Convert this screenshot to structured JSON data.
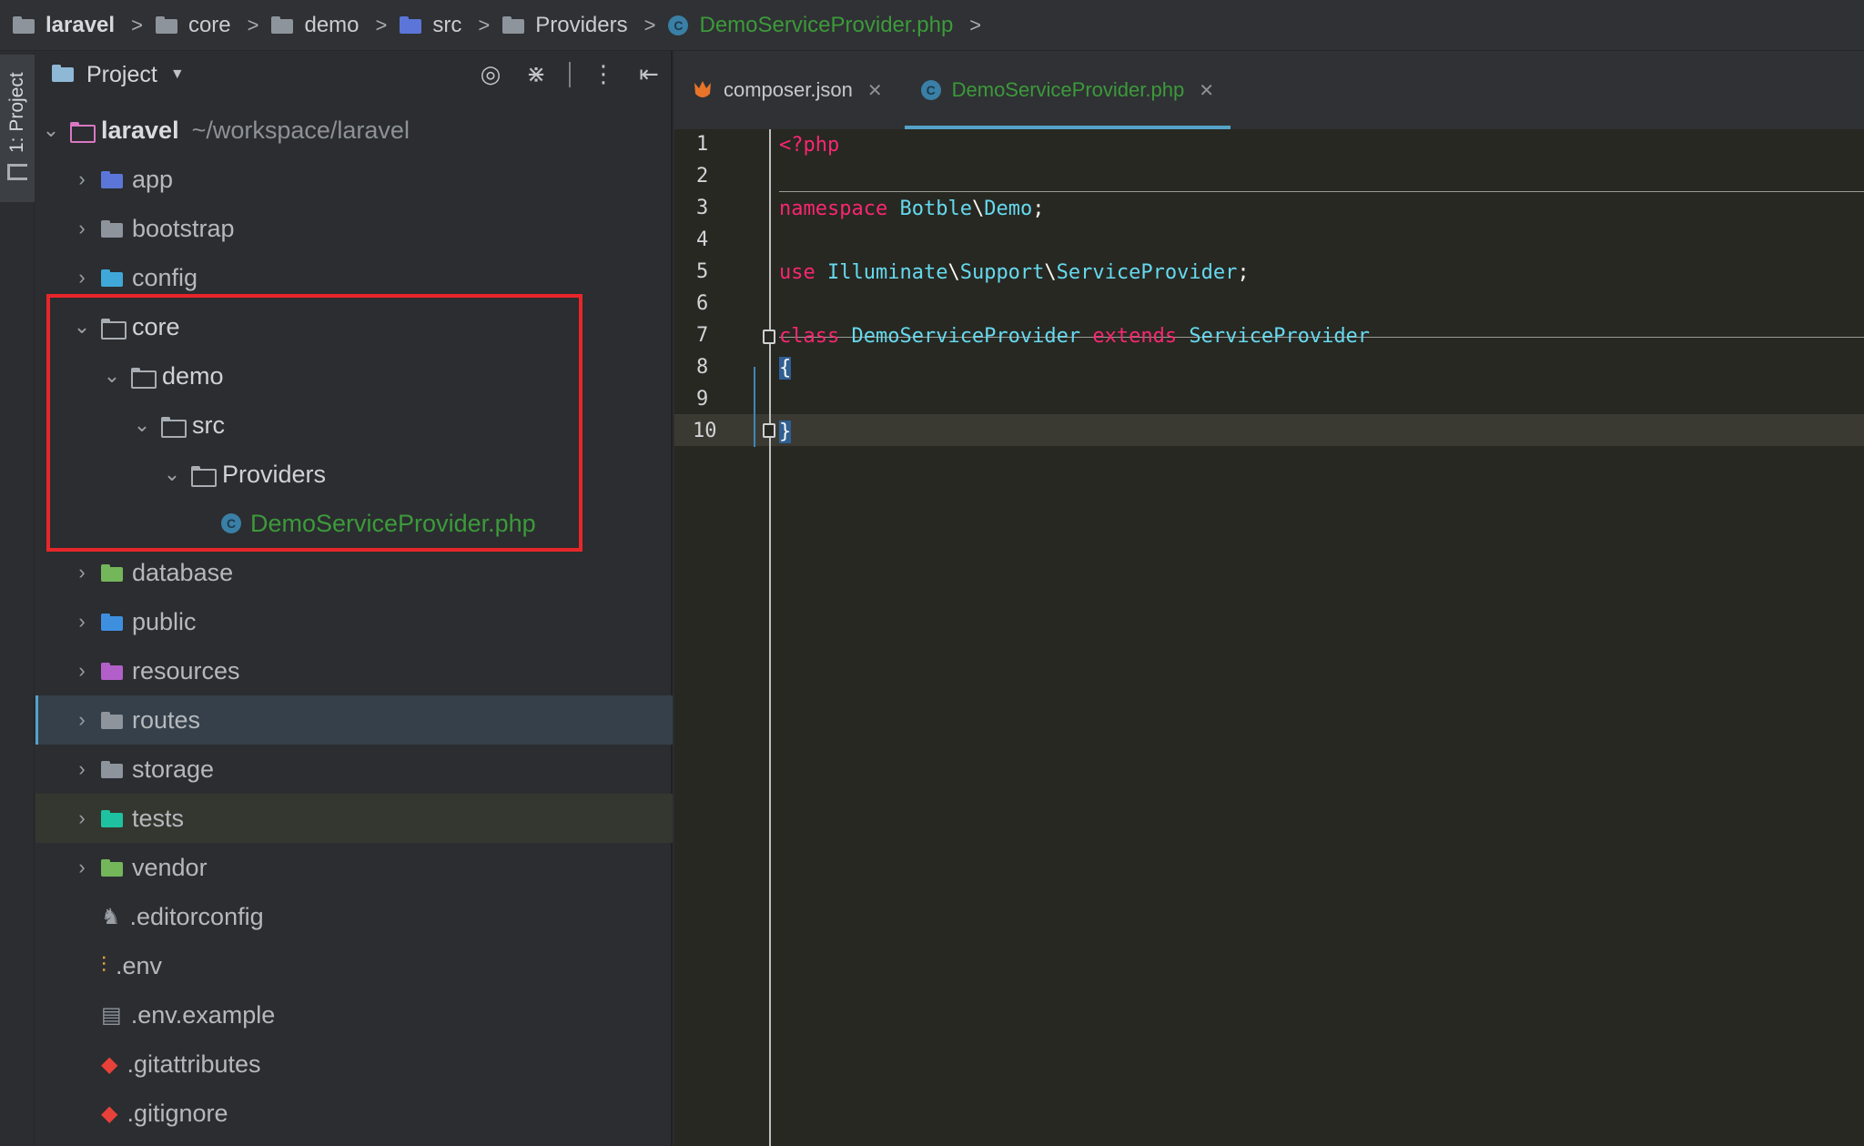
{
  "breadcrumb": [
    "laravel",
    "core",
    "demo",
    "src",
    "Providers",
    "DemoServiceProvider.php"
  ],
  "toolwindow": {
    "tab_label": "1: Project"
  },
  "project_panel": {
    "title": "Project",
    "root": {
      "name": "laravel",
      "path": "~/workspace/laravel"
    },
    "items": [
      {
        "name": "app"
      },
      {
        "name": "bootstrap"
      },
      {
        "name": "config"
      },
      {
        "name": "core"
      },
      {
        "name": "demo"
      },
      {
        "name": "src"
      },
      {
        "name": "Providers"
      },
      {
        "name": "DemoServiceProvider.php"
      },
      {
        "name": "database"
      },
      {
        "name": "public"
      },
      {
        "name": "resources"
      },
      {
        "name": "routes"
      },
      {
        "name": "storage"
      },
      {
        "name": "tests"
      },
      {
        "name": "vendor"
      },
      {
        "name": ".editorconfig"
      },
      {
        "name": ".env"
      },
      {
        "name": ".env.example"
      },
      {
        "name": ".gitattributes"
      },
      {
        "name": ".gitignore"
      }
    ]
  },
  "tabs": [
    {
      "label": "composer.json"
    },
    {
      "label": "DemoServiceProvider.php"
    }
  ],
  "editor": {
    "line_numbers": [
      "1",
      "2",
      "3",
      "4",
      "5",
      "6",
      "7",
      "8",
      "9",
      "10"
    ],
    "code": {
      "l1": "<?php",
      "l3_kw": "namespace",
      "l3_a": "Botble",
      "l3_sep": "\\",
      "l3_b": "Demo",
      "l3_end": ";",
      "l5_kw": "use",
      "l5_a": "Illuminate",
      "l5_s1": "\\",
      "l5_b": "Support",
      "l5_s2": "\\",
      "l5_c": "ServiceProvider",
      "l5_end": ";",
      "l7_kw": "class",
      "l7_name": "DemoServiceProvider",
      "l7_ext": "extends",
      "l7_parent": "ServiceProvider",
      "l8": "{",
      "l10": "}"
    }
  },
  "colors": {
    "keyword": "#f92672",
    "type": "#66d9ef",
    "file_green": "#3c9a3a",
    "highlight_red": "#e8262a",
    "accent_blue": "#55a3c9"
  }
}
